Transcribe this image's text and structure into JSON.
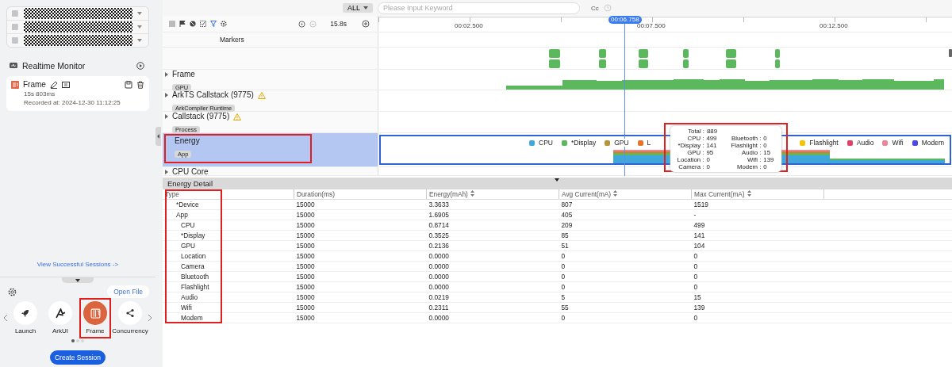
{
  "sidebar": {
    "section_title": "Realtime Monitor",
    "session": {
      "name": "Frame",
      "duration": "15s 803ms",
      "recorded": "Recorded at: 2024-12-30 11:12:25"
    },
    "link": "View Successful Sessions ->",
    "open_file": "Open File",
    "templates": [
      {
        "label": "Launch",
        "selected": false
      },
      {
        "label": "ArkUI",
        "selected": false
      },
      {
        "label": "Frame",
        "selected": true
      },
      {
        "label": "Concurrency",
        "selected": false
      }
    ],
    "pager": [
      {
        "selected": true
      },
      {
        "selected": false
      },
      {
        "selected": false
      }
    ],
    "create_button": "Create Session"
  },
  "search": {
    "filter": "ALL",
    "placeholder": "Please Input Keyword",
    "case_label": "Cc"
  },
  "timeline": {
    "zoom": "15.8s",
    "ticks": [
      "00:02.500",
      "00:07.500",
      "00:12.500"
    ],
    "cursor": "00:06.758"
  },
  "tracks": [
    {
      "kind": "markers",
      "name": "Markers",
      "selected": false
    },
    {
      "kind": "blocks",
      "selected": false
    },
    {
      "kind": "frame",
      "name": "Frame",
      "tag": "GPU",
      "expandable": true,
      "warning": false,
      "selected": false
    },
    {
      "kind": "plain",
      "name": "ArkTS Callstack (9775)",
      "tag": "ArkCompiler Runtime",
      "expandable": true,
      "warning": true,
      "selected": false
    },
    {
      "kind": "plain",
      "name": "Callstack (9775)",
      "tag": "Process",
      "expandable": true,
      "warning": true,
      "selected": false
    },
    {
      "kind": "energy",
      "name": "Energy",
      "tag": "App",
      "expandable": false,
      "warning": false,
      "selected": true
    },
    {
      "kind": "plain",
      "name": "CPU Core",
      "expandable": true,
      "warning": false,
      "selected": false
    }
  ],
  "energy_legend": [
    {
      "label": "CPU",
      "color": "#3fa7dc"
    },
    {
      "label": "*Display",
      "color": "#5cb85c"
    },
    {
      "label": "GPU",
      "color": "#b8933a"
    },
    {
      "label": "L",
      "color": "#e8732a"
    },
    {
      "label": "Flashlight",
      "color": "#f5c400"
    },
    {
      "label": "Audio",
      "color": "#e0406a"
    },
    {
      "label": "Wifi",
      "color": "#e8879a"
    },
    {
      "label": "Modem",
      "color": "#4a4ae0"
    }
  ],
  "tooltip": {
    "total_label": "Total :",
    "total": "889",
    "rows": [
      {
        "left_label": "CPU :",
        "left_value": "499",
        "right_label": "Bluetooth :",
        "right_value": "0"
      },
      {
        "left_label": "*Display :",
        "left_value": "141",
        "right_label": "Flashlight :",
        "right_value": "0"
      },
      {
        "left_label": "GPU :",
        "left_value": "95",
        "right_label": "Audio :",
        "right_value": "15"
      },
      {
        "left_label": "Location :",
        "left_value": "0",
        "right_label": "Wifi :",
        "right_value": "139"
      },
      {
        "left_label": "Camera :",
        "left_value": "0",
        "right_label": "Modem :",
        "right_value": "0"
      }
    ]
  },
  "energy_detail": {
    "title": "Energy Detail",
    "columns": [
      {
        "label": "Type",
        "sortable": false
      },
      {
        "label": "Duration(ms)",
        "sortable": false
      },
      {
        "label": "Energy(mAh)",
        "sortable": true
      },
      {
        "label": "Avg Current(mA)",
        "sortable": true
      },
      {
        "label": "Max Current(mA)",
        "sortable": true
      }
    ],
    "rows": [
      {
        "cells": [
          "*Device",
          "15000",
          "3.3633",
          "807",
          "1519"
        ]
      },
      {
        "cells": [
          "App",
          "15000",
          "1.6905",
          "405",
          "-"
        ],
        "children": [
          {
            "cells": [
              "CPU",
              "15000",
              "0.8714",
              "209",
              "499"
            ]
          },
          {
            "cells": [
              "*Display",
              "15000",
              "0.3525",
              "85",
              "141"
            ]
          },
          {
            "cells": [
              "GPU",
              "15000",
              "0.2136",
              "51",
              "104"
            ]
          },
          {
            "cells": [
              "Location",
              "15000",
              "0.0000",
              "0",
              "0"
            ]
          },
          {
            "cells": [
              "Camera",
              "15000",
              "0.0000",
              "0",
              "0"
            ]
          },
          {
            "cells": [
              "Bluetooth",
              "15000",
              "0.0000",
              "0",
              "0"
            ]
          },
          {
            "cells": [
              "Flashlight",
              "15000",
              "0.0000",
              "0",
              "0"
            ]
          },
          {
            "cells": [
              "Audio",
              "15000",
              "0.0219",
              "5",
              "15"
            ]
          },
          {
            "cells": [
              "Wifi",
              "15000",
              "0.2311",
              "55",
              "139"
            ]
          },
          {
            "cells": [
              "Modem",
              "15000",
              "0.0000",
              "0",
              "0"
            ]
          }
        ]
      }
    ]
  }
}
